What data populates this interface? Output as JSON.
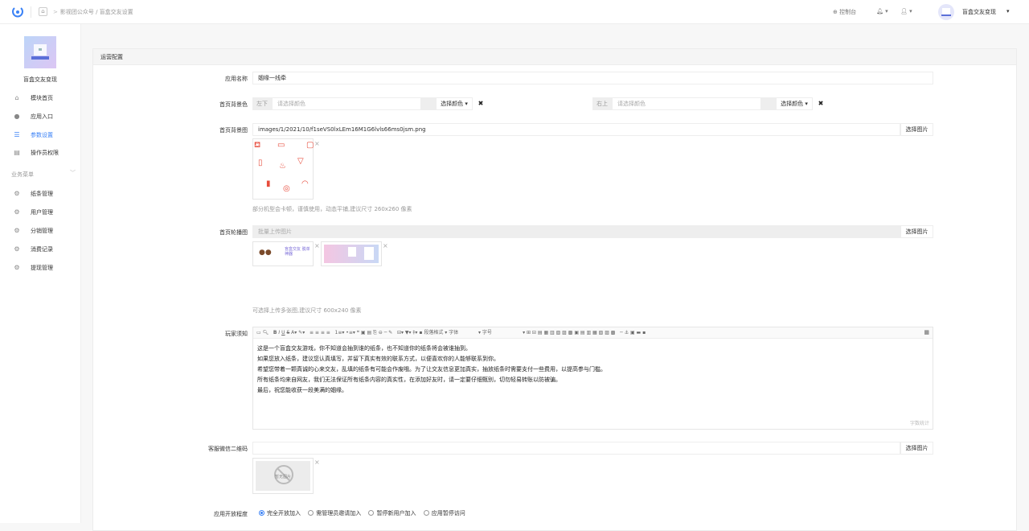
{
  "topbar": {
    "breadcrumb": [
      "影视团公众号",
      "盲盒交友设置"
    ],
    "console_label": "控制台",
    "username": "盲盒交友变现"
  },
  "sidebar": {
    "app_name": "盲盒交友变现",
    "items": [
      {
        "label": "模块首页",
        "icon": "home-icon"
      },
      {
        "label": "应用入口",
        "icon": "chat-icon"
      },
      {
        "label": "参数设置",
        "icon": "settings-list-icon"
      },
      {
        "label": "操作员权限",
        "icon": "document-icon"
      }
    ],
    "group_label": "业务菜单",
    "group_items": [
      {
        "label": "纸条管理",
        "icon": "gear-icon"
      },
      {
        "label": "用户管理",
        "icon": "gear-icon"
      },
      {
        "label": "分销管理",
        "icon": "gear-icon"
      },
      {
        "label": "消费记录",
        "icon": "gear-icon"
      },
      {
        "label": "提现管理",
        "icon": "gear-icon"
      }
    ]
  },
  "form": {
    "section_title": "运营配置",
    "app_name_label": "应用名称",
    "app_name_value": "姻缘一线牵",
    "bg_color_label": "首页背景色",
    "left_addon": "左下",
    "right_addon": "右上",
    "color_placeholder": "请选择颜色",
    "choose_color": "选择颜色",
    "bg_image_label": "首页背景图",
    "bg_image_value": "images/1/2021/10/f1seVS0lxLEm16M1G6lvls66ms0jsm.png",
    "choose_image": "选择图片",
    "bg_hint": "部分机型会卡顿，谨慎使用，动态平铺,建议尺寸 260x260 像素",
    "carousel_label": "首页轮播图",
    "carousel_placeholder": "批量上传图片",
    "carousel_hint": "可选择上传多张图,建议尺寸 600x240 像素",
    "banner1_text": "盲盒交友 脱单神器",
    "notice_label": "玩家须知",
    "notice_lines": [
      "这是一个盲盒交友游戏，你不知道会抽到谁的纸条，也不知道你的纸条将会被谁抽到。",
      "如果您放入纸条，建议您认真填写，并留下真实有效的联系方式，以便喜欢你的人能够联系到你。",
      "希望您带着一颗真诚的心来交友，乱填的纸条有可能会作废哦。为了让交友信息更加真实，抽放纸条时需要支付一些费用，以提高参与门槛。",
      "所有纸条均来自网友，我们无法保证所有纸条内容的真实性，在添加好友时，请一定要仔细甄别，切勿轻易转账以防被骗。",
      "最后，祝您能收获一段美满的姻缘。"
    ],
    "word_count": "字数统计",
    "toolbar": {
      "para": "段落格式",
      "font": "字体",
      "size": "字号"
    },
    "qrcode_label": "客服微信二维码",
    "no_image": "暂无图片",
    "access_label": "应用开放程度",
    "access_options": [
      "完全开放加入",
      "需管理员邀请加入",
      "暂停新用户加入",
      "应用暂停访问"
    ],
    "access_selected": 0
  }
}
